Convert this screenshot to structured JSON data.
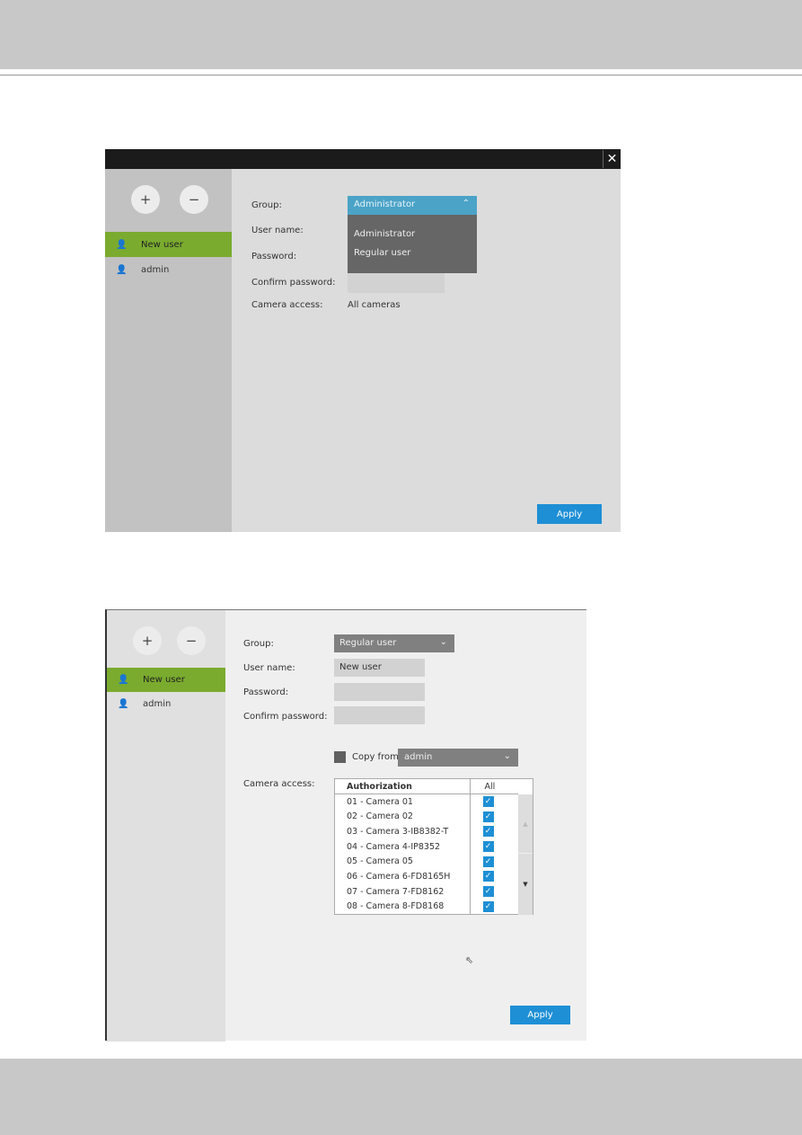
{
  "dialog1": {
    "close_icon": "close-icon",
    "users": [
      {
        "label": "New user",
        "selected": true
      },
      {
        "label": "admin",
        "selected": false
      }
    ],
    "labels": {
      "group": "Group:",
      "username": "User name:",
      "password": "Password:",
      "confirm": "Confirm password:",
      "camera_access": "Camera access:"
    },
    "group_value": "Administrator",
    "group_options": [
      "Administrator",
      "Regular user"
    ],
    "camera_access_value": "All cameras",
    "apply": "Apply"
  },
  "dialog2": {
    "users": [
      {
        "label": "New user",
        "selected": true
      },
      {
        "label": "admin",
        "selected": false
      }
    ],
    "labels": {
      "group": "Group:",
      "username": "User name:",
      "password": "Password:",
      "confirm": "Confirm password:",
      "camera_access": "Camera access:"
    },
    "group_value": "Regular user",
    "username_value": "New user",
    "copy_from_label": "Copy from",
    "copy_from_checked": false,
    "copy_from_value": "admin",
    "table": {
      "headers": [
        "Authorization",
        "All"
      ],
      "rows": [
        {
          "name": "01 - Camera 01",
          "checked": true
        },
        {
          "name": "02 - Camera 02",
          "checked": true
        },
        {
          "name": "03 - Camera 3-IB8382-T",
          "checked": true
        },
        {
          "name": "04 - Camera 4-IP8352",
          "checked": true
        },
        {
          "name": "05 - Camera 05",
          "checked": true
        },
        {
          "name": "06 - Camera 6-FD8165H",
          "checked": true
        },
        {
          "name": "07 - Camera 7-FD8162",
          "checked": true
        },
        {
          "name": "08 - Camera 8-FD8168",
          "checked": true
        }
      ]
    },
    "apply": "Apply"
  },
  "colors": {
    "selected": "#7aab2f",
    "accent": "#1e8fd5",
    "dropdown_header": "#4ba3c7"
  }
}
